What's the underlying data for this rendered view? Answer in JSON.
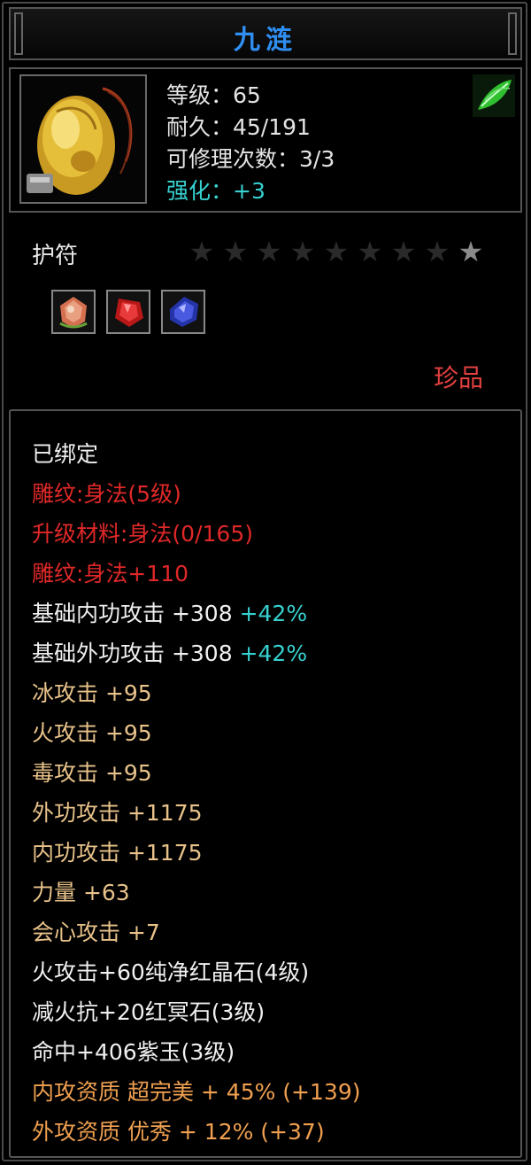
{
  "item": {
    "name": "九涟",
    "level": "等级：65",
    "durability": "耐久：45/191",
    "repair": "可修理次数：3/3",
    "enhance": "强化：+3"
  },
  "category": "护符",
  "stars": {
    "total": 9,
    "lit": 1
  },
  "gems": [
    "orange-crystal-gem-icon",
    "red-ruby-gem-icon",
    "blue-sapphire-gem-icon"
  ],
  "rarity": "珍品",
  "attributes": [
    {
      "text": "已绑定",
      "color": "white"
    },
    {
      "text": "雕纹:身法(5级)",
      "color": "red"
    },
    {
      "text": "升级材料:身法(0/165)",
      "color": "red"
    },
    {
      "text": "雕纹:身法+110",
      "color": "red"
    },
    {
      "text": "基础内功攻击  +308",
      "extra": "+42%",
      "color": "white"
    },
    {
      "text": "基础外功攻击  +308",
      "extra": "+42%",
      "color": "white"
    },
    {
      "text": "冰攻击  +95",
      "color": "tan"
    },
    {
      "text": "火攻击  +95",
      "color": "tan"
    },
    {
      "text": "毒攻击  +95",
      "color": "tan"
    },
    {
      "text": "外功攻击  +1175",
      "color": "tan"
    },
    {
      "text": "内功攻击  +1175",
      "color": "tan"
    },
    {
      "text": "力量  +63",
      "color": "tan"
    },
    {
      "text": "会心攻击  +7",
      "color": "tan"
    },
    {
      "text": "火攻击+60纯净红晶石(4级)",
      "color": "white"
    },
    {
      "text": "减火抗+20红冥石(3级)",
      "color": "white"
    },
    {
      "text": "命中+406紫玉(3级)",
      "color": "white"
    },
    {
      "text": "内攻资质  超完美  +  45%  (+139)",
      "color": "orange"
    },
    {
      "text": "外攻资质  优秀  +  12%  (+37)",
      "color": "orange"
    }
  ],
  "colors": {
    "title": "#2f8ff3",
    "red": "#e02828",
    "tan": "#e8c28a",
    "orange": "#f0a050",
    "cyan": "#38d0d0"
  }
}
